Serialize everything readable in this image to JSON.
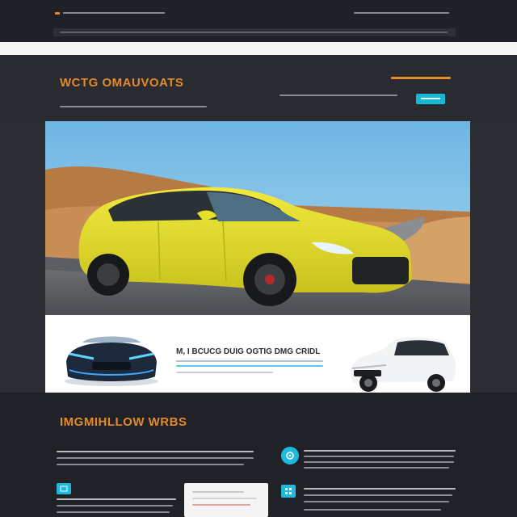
{
  "header": {
    "headline": "WCTG OMAUVOATS"
  },
  "hero": {
    "caption": "M, I BCUCG DUIG OGTIG DMG CRIDL",
    "main_car_color": "#e6e02a",
    "sky_color": "#7fc4e6",
    "hill_color": "#c78a4e"
  },
  "section": {
    "title": "IMGMIHLLOW WRBS"
  },
  "colors": {
    "accent_orange": "#e38a2a",
    "accent_cyan": "#18b7d6",
    "background_dark": "#24262c",
    "surface_white": "#ffffff"
  },
  "icons": {
    "feature_icon_round": "gear-icon",
    "feature_icon_square_1": "document-icon",
    "feature_icon_square_2": "grid-icon"
  }
}
